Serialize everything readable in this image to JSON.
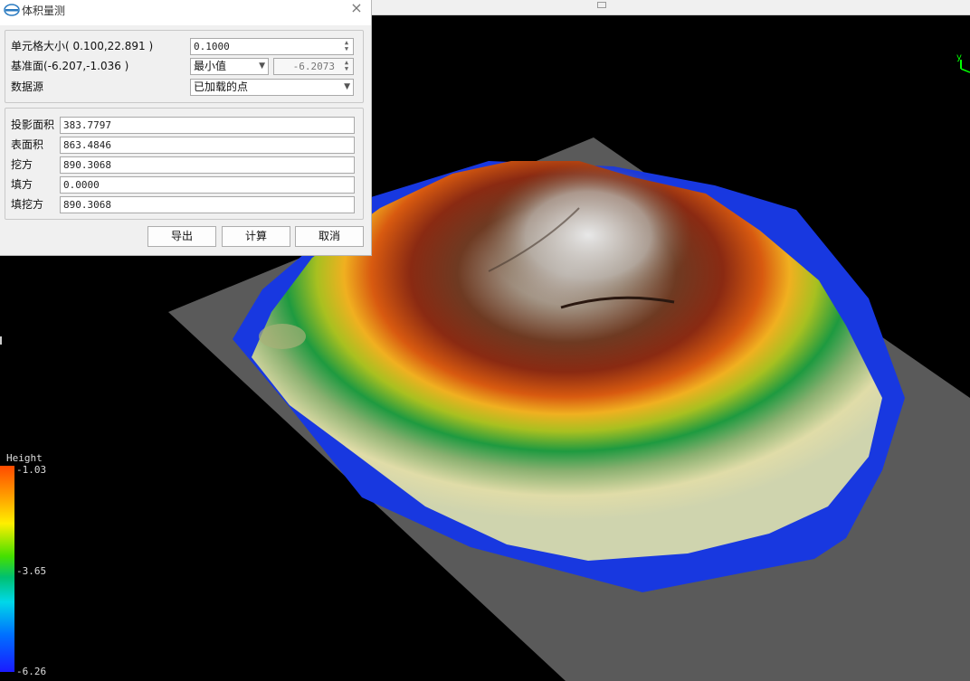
{
  "dialog": {
    "title": "体积量测",
    "close_label": "×",
    "params": {
      "cell_size_label": "单元格大小( 0.100,22.891 )",
      "cell_size_value": "0.1000",
      "base_label": "基准面(-6.207,-1.036 )",
      "base_mode": "最小值",
      "base_value": "-6.2073",
      "source_label": "数据源",
      "source_value": "已加载的点"
    },
    "results": [
      {
        "label": "投影面积",
        "value": "383.7797"
      },
      {
        "label": "表面积",
        "value": "863.4846"
      },
      {
        "label": "挖方",
        "value": "890.3068"
      },
      {
        "label": "填方",
        "value": "0.0000"
      },
      {
        "label": "填挖方",
        "value": "890.3068"
      }
    ],
    "buttons": {
      "export": "导出",
      "compute": "计算",
      "cancel": "取消"
    }
  },
  "legend": {
    "title": "Height",
    "max": "-1.03",
    "mid": "-3.65",
    "min": "-6.26",
    "colors": [
      "#ff4a00",
      "#ffef00",
      "#44e000",
      "#00d8e8",
      "#1a1aff"
    ]
  },
  "axis": {
    "y_label": "y",
    "axis_color": "#00ff00"
  },
  "icons": {
    "app": "app-logo-icon",
    "close": "close-icon",
    "dropdown": "chevron-down-icon",
    "spinner": "spinner-icon"
  }
}
